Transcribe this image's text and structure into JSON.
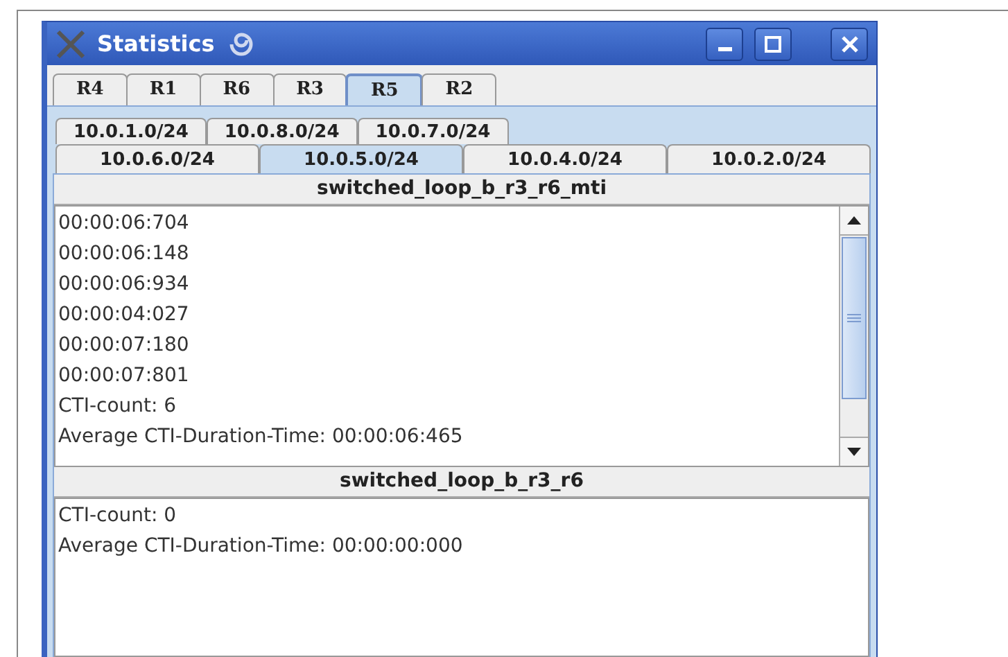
{
  "window": {
    "title": "Statistics"
  },
  "router_tabs": [
    {
      "label": "R4",
      "selected": false
    },
    {
      "label": "R1",
      "selected": false
    },
    {
      "label": "R6",
      "selected": false
    },
    {
      "label": "R3",
      "selected": false
    },
    {
      "label": "R5",
      "selected": true
    },
    {
      "label": "R2",
      "selected": false
    }
  ],
  "network_tab_rows": [
    [
      {
        "label": "10.0.1.0/24",
        "selected": false
      },
      {
        "label": "10.0.8.0/24",
        "selected": false
      },
      {
        "label": "10.0.7.0/24",
        "selected": false
      }
    ],
    [
      {
        "label": "10.0.6.0/24",
        "selected": false
      },
      {
        "label": "10.0.5.0/24",
        "selected": true
      },
      {
        "label": "10.0.4.0/24",
        "selected": false
      },
      {
        "label": "10.0.2.0/24",
        "selected": false
      }
    ]
  ],
  "sections": [
    {
      "title": "switched_loop_b_r3_r6_mti",
      "scrollbar": true,
      "lines": [
        "00:00:06:704",
        "00:00:06:148",
        "00:00:06:934",
        "00:00:04:027",
        "00:00:07:180",
        "00:00:07:801",
        "CTI-count: 6",
        "Average CTI-Duration-Time: 00:00:06:465"
      ]
    },
    {
      "title": "switched_loop_b_r3_r6",
      "scrollbar": false,
      "lines": [
        "CTI-count: 0",
        "Average CTI-Duration-Time: 00:00:00:000"
      ]
    }
  ]
}
